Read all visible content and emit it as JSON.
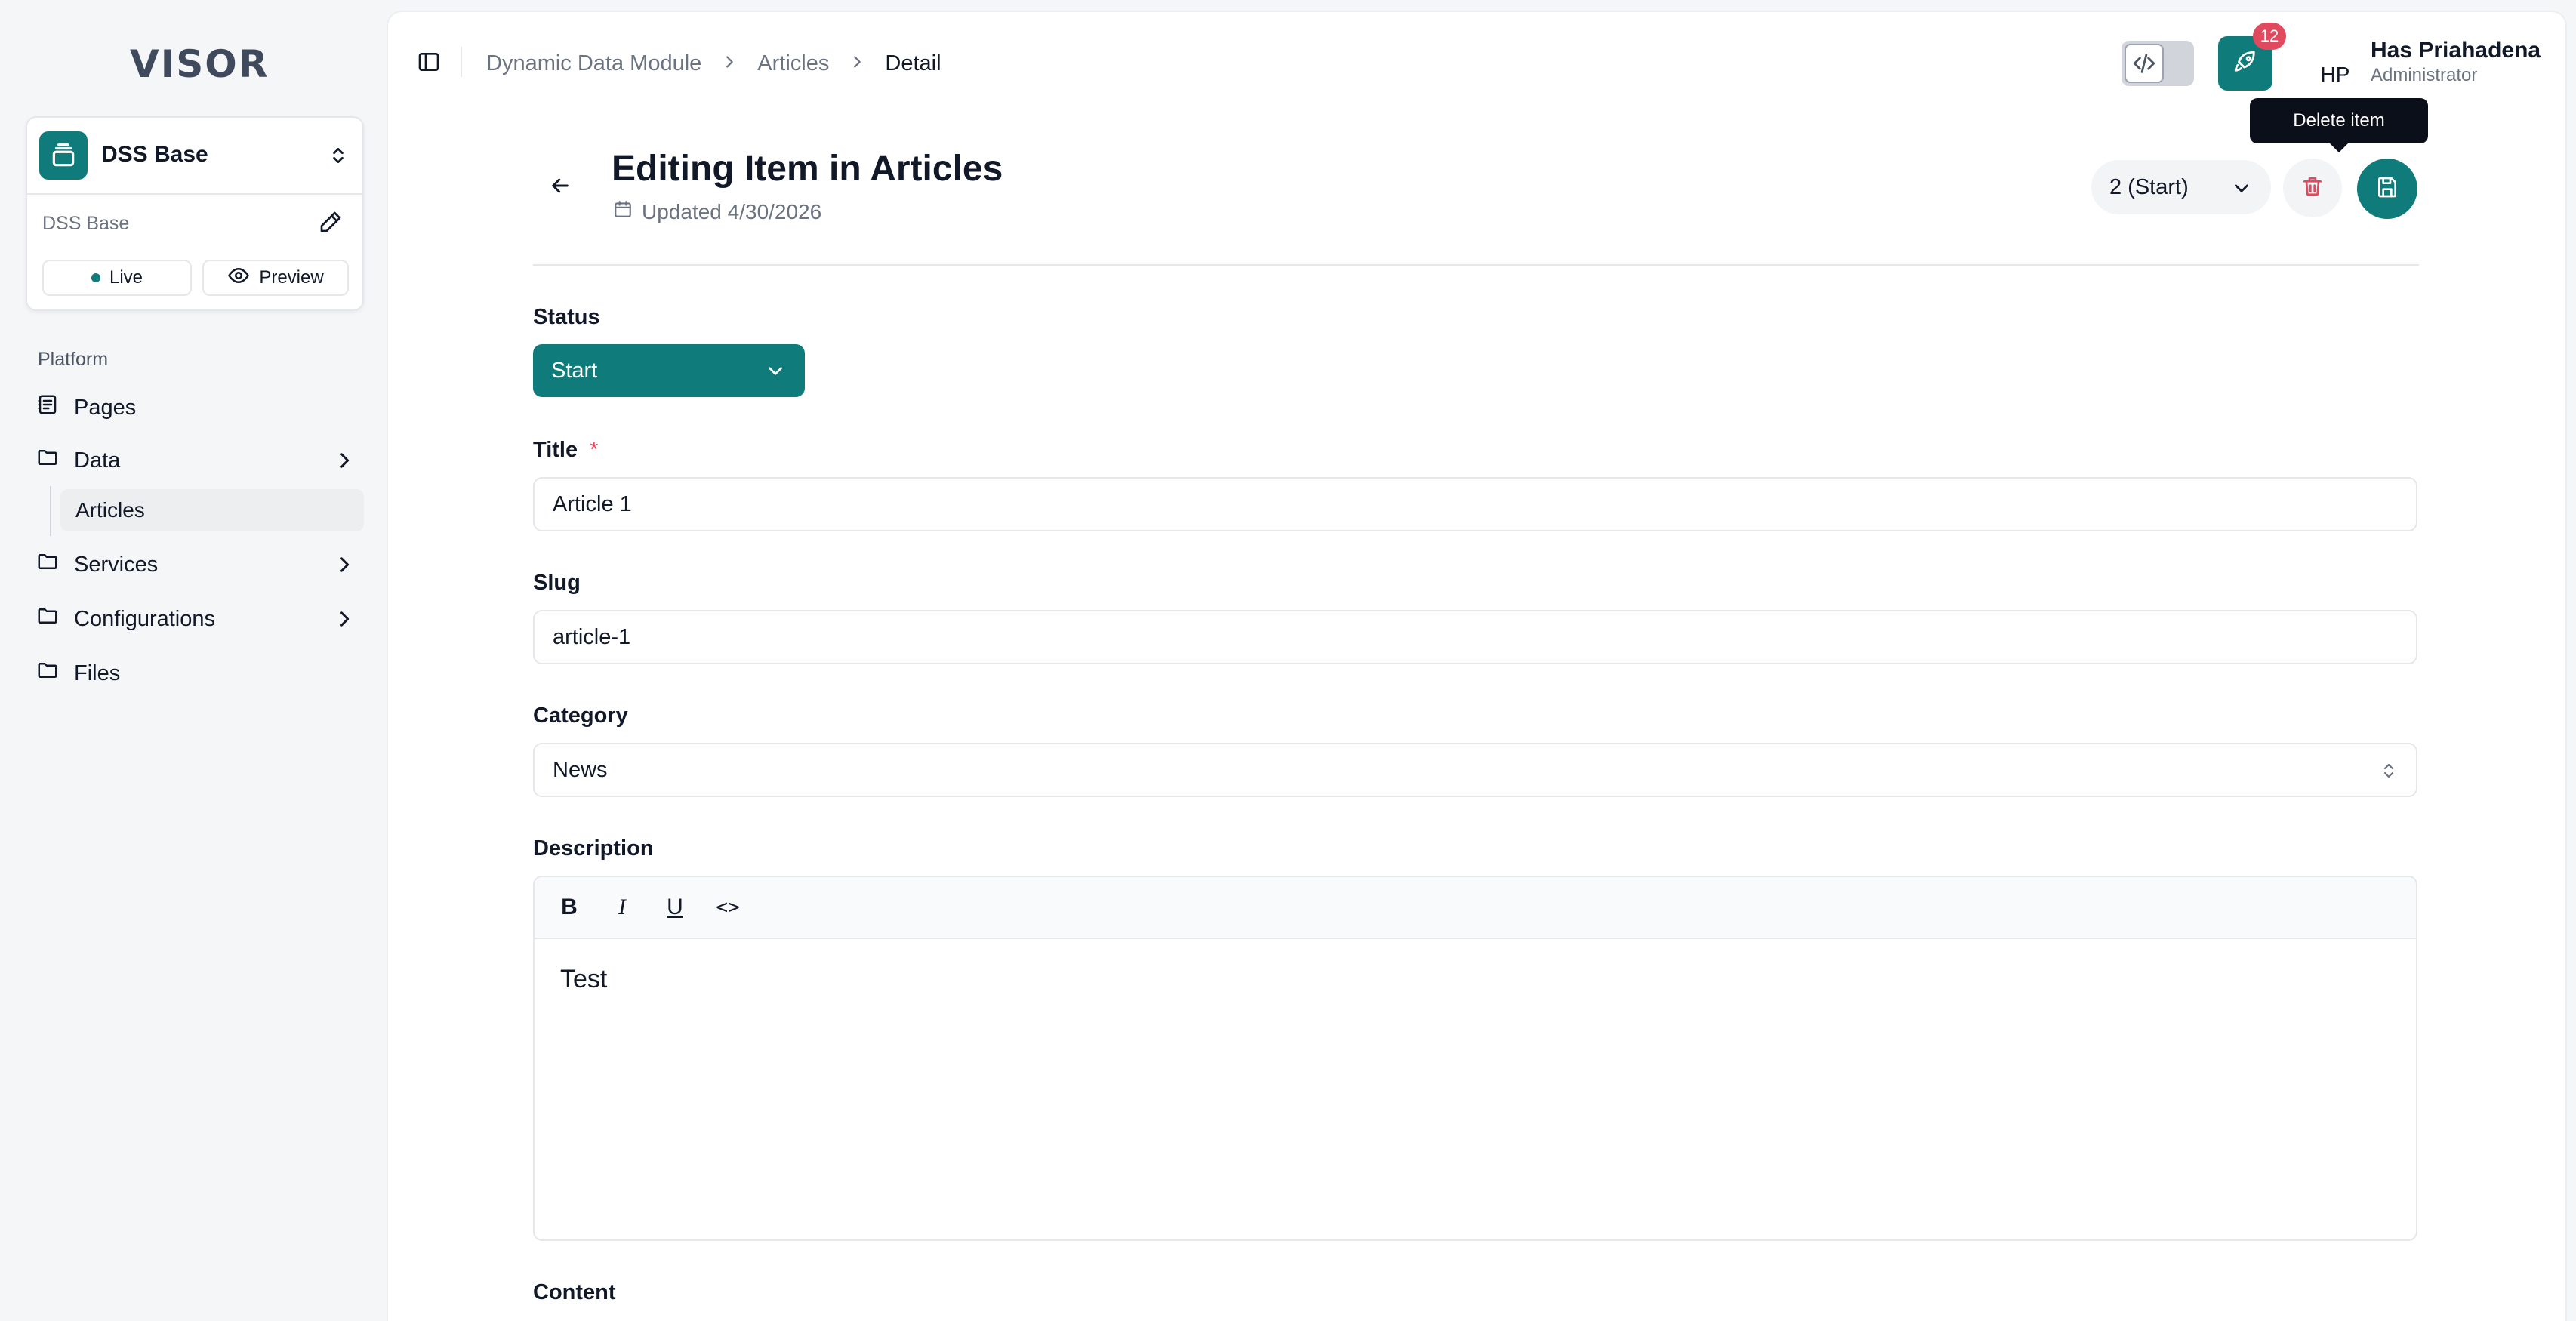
{
  "app": {
    "logo": "VISOR"
  },
  "project": {
    "name": "DSS Base",
    "subtitle": "DSS Base",
    "live_label": "Live",
    "preview_label": "Preview",
    "accent": "#0f7b7b"
  },
  "sidebar": {
    "section_label": "Platform",
    "items": [
      {
        "label": "Pages",
        "icon": "pages-icon"
      },
      {
        "label": "Data",
        "icon": "folder-icon",
        "expandable": true
      },
      {
        "label": "Services",
        "icon": "folder-icon",
        "expandable": true
      },
      {
        "label": "Configurations",
        "icon": "folder-icon",
        "expandable": true
      },
      {
        "label": "Files",
        "icon": "folder-icon"
      }
    ],
    "data_children": [
      {
        "label": "Articles",
        "active": true
      }
    ]
  },
  "breadcrumb": {
    "items": [
      "Dynamic Data Module",
      "Articles"
    ],
    "current": "Detail"
  },
  "header": {
    "notification_count": "12",
    "user": {
      "initials": "HP",
      "name": "Has Priahadena",
      "role": "Administrator"
    },
    "tooltip": "Delete item"
  },
  "page": {
    "title": "Editing Item in Articles",
    "updated": "Updated 4/30/2026",
    "version": "2 (Start)"
  },
  "form": {
    "status": {
      "label": "Status",
      "value": "Start"
    },
    "title": {
      "label": "Title",
      "required_mark": "*",
      "value": "Article 1"
    },
    "slug": {
      "label": "Slug",
      "value": "article-1"
    },
    "category": {
      "label": "Category",
      "value": "News"
    },
    "description": {
      "label": "Description",
      "toolbar": [
        "bold",
        "italic",
        "underline",
        "code"
      ],
      "bold_glyph": "B",
      "italic_glyph": "I",
      "underline_glyph": "U",
      "code_glyph": "<>",
      "value": "Test"
    },
    "content": {
      "label": "Content"
    }
  },
  "colors": {
    "accent": "#0f7b7b",
    "danger": "#e1495f",
    "tooltip_bg": "#0b0f19"
  }
}
